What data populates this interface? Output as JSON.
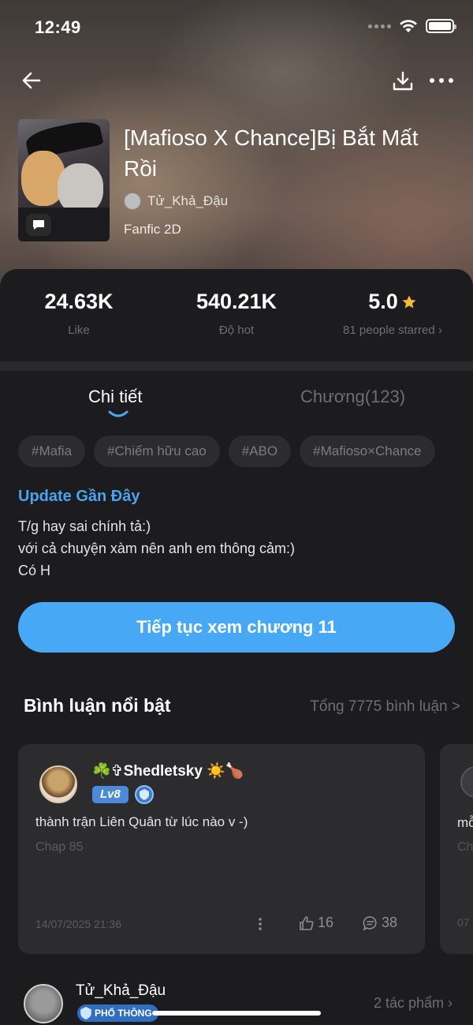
{
  "status": {
    "time": "12:49"
  },
  "book": {
    "title": "[Mafioso X Chance]Bị Bắt Mất Rồi",
    "author": "Tử_Khả_Đậu",
    "genre": "Fanfic 2D"
  },
  "stats": {
    "likes": {
      "value": "24.63K",
      "label": "Like"
    },
    "hot": {
      "value": "540.21K",
      "label": "Độ hot"
    },
    "rating": {
      "value": "5.0",
      "label": "81 people starred ›"
    }
  },
  "tabs": {
    "detail": "Chi tiết",
    "chapters": "Chương(123)"
  },
  "tags": [
    "#Mafia",
    "#Chiếm hữu cao",
    "#ABO",
    "#Mafioso×Chance"
  ],
  "update": {
    "title": "Update Gần Đây",
    "line1": "T/g hay sai chính tả:)",
    "line2": "với cả chuyện xàm nên anh em thông cảm:)",
    "line3": "Có H"
  },
  "cta_label": "Tiếp tục xem chương 11",
  "comments_section": {
    "title": "Bình luận nổi bật",
    "total_link": "Tổng 7775 bình luận >"
  },
  "comment": {
    "username": "☘️✞Shedletsky ☀️🍗",
    "level": "Lv8",
    "text": "thành trận Liên Quân từ lúc nào v -)",
    "chapter": "Chap 85",
    "date": "14/07/2025 21:36",
    "likes": "16",
    "replies": "38"
  },
  "comment_peek": {
    "text": "mỗ",
    "chapter": "Ch",
    "date": "07"
  },
  "author_row": {
    "name": "Tử_Khả_Đậu",
    "badge": "PHỔ THÔNG",
    "works": "2 tác phẩm ›"
  },
  "colors": {
    "accent": "#47a9f5",
    "link": "#4aa3f0",
    "background": "#1c1c1e",
    "card": "#2c2c2e",
    "star": "#f5b83d"
  }
}
